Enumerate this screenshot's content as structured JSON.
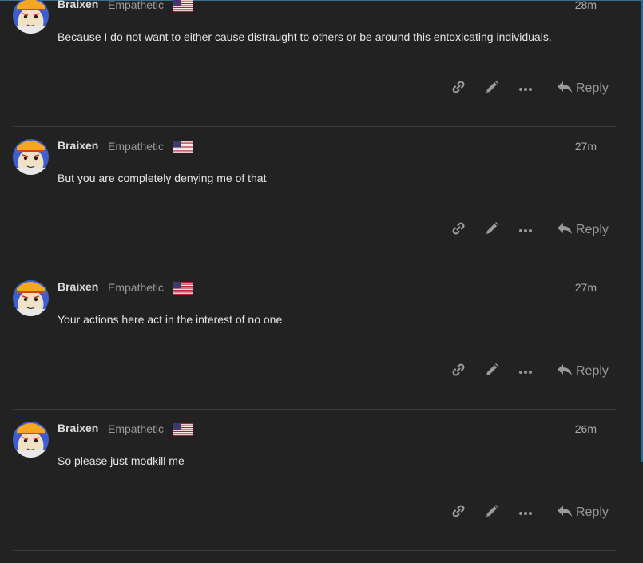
{
  "posts": [
    {
      "username": "Braixen",
      "title": "Empathetic",
      "date": "28m",
      "text": "Because I do not want to either cause distraught to others or be around this entoxicating individuals.",
      "reply_label": "Reply"
    },
    {
      "username": "Braixen",
      "title": "Empathetic",
      "date": "27m",
      "text": "But you are completely denying me of that",
      "reply_label": "Reply"
    },
    {
      "username": "Braixen",
      "title": "Empathetic",
      "date": "27m",
      "text": "Your actions here act in the interest of no one",
      "reply_label": "Reply"
    },
    {
      "username": "Braixen",
      "title": "Empathetic",
      "date": "26m",
      "text": "So please just modkill me",
      "reply_label": "Reply"
    }
  ],
  "icons": {
    "link": "link-icon",
    "edit": "pencil-icon",
    "more": "ellipsis-icon",
    "reply": "reply-arrow-icon",
    "flag": "us-flag-icon"
  },
  "colors": {
    "background": "#222222",
    "text": "#dddddd",
    "muted": "#9a9a9a",
    "divider": "#3a3a3a"
  }
}
